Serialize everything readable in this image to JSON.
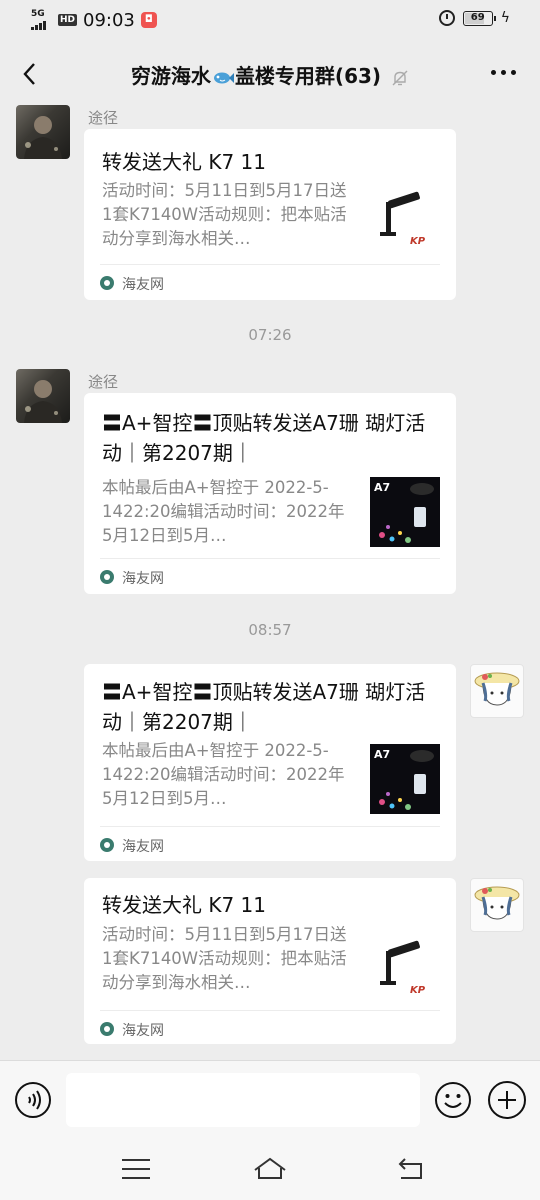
{
  "status": {
    "network": "5G",
    "hd": "HD",
    "time": "09:03",
    "battery": "69",
    "battery_level": 0.69
  },
  "header": {
    "title_part1": "穷游海水",
    "title_part2": "盖楼专用群(63)",
    "emoji_icon": "fish-icon",
    "muted_icon": "bell-off-icon"
  },
  "messages": [
    {
      "side": "left",
      "sender": "途径",
      "title": "转发送大礼 K7 11",
      "desc": "活动时间：5月11日到5月17日送1套K7140W活动规则：把本贴活动分享到海水相关…",
      "source": "海友网",
      "thumb_icon": "k7-lamp"
    },
    {
      "timestamp": "07:26"
    },
    {
      "side": "left",
      "sender": "途径",
      "title": "〓A+智控〓顶贴转发送A7珊 瑚灯活动｜第2207期｜",
      "desc": "本帖最后由A+智控于 2022-5-1422:20编辑活动时间：2022年5月12日到5月…",
      "source": "海友网",
      "thumb_icon": "a7-lamp",
      "thumb_label": "A7"
    },
    {
      "timestamp": "08:57"
    },
    {
      "side": "right",
      "title": "〓A+智控〓顶贴转发送A7珊 瑚灯活动｜第2207期｜",
      "desc": "本帖最后由A+智控于 2022-5-1422:20编辑活动时间：2022年5月12日到5月…",
      "source": "海友网",
      "thumb_icon": "a7-lamp",
      "thumb_label": "A7"
    },
    {
      "side": "right",
      "title": "转发送大礼 K7 11",
      "desc": "活动时间：5月11日到5月17日送1套K7140W活动规则：把本贴活动分享到海水相关…",
      "source": "海友网",
      "thumb_icon": "k7-lamp"
    }
  ],
  "input": {
    "placeholder": "",
    "voice_icon": "voice-icon",
    "emoji_icon": "emoji-icon",
    "plus_icon": "plus-icon"
  },
  "colors": {
    "background": "#ededed",
    "card": "#ffffff",
    "source_icon": "#3a7b6e"
  }
}
